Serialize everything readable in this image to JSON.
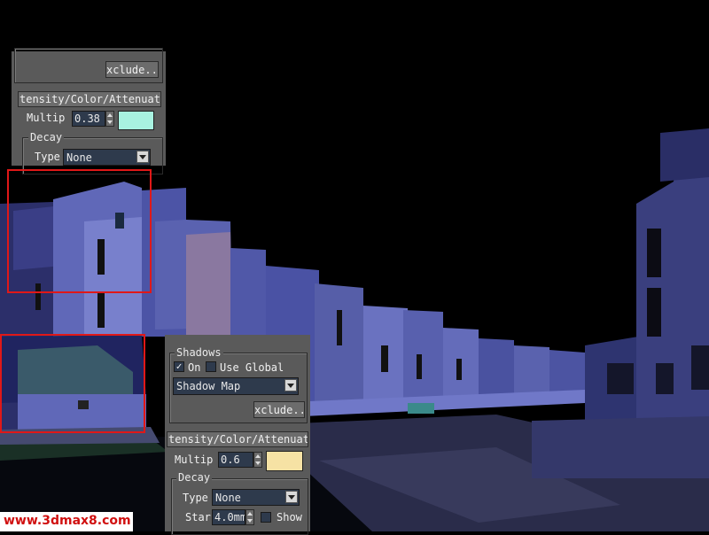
{
  "colors": {
    "panel_bg": "#5a5a5a",
    "field_bg": "#2e3a4c",
    "highlight": "#e01818",
    "upper_swatch": "#a8f2e0",
    "lower_swatch": "#f6e2a4",
    "scene_building": "#3c46a0",
    "watermark_text": "#d01010"
  },
  "upper_panel": {
    "exclude_label": "xclude..",
    "rollout_title": "tensity/Color/Attenuati",
    "multiplier_label": "Multip",
    "multiplier_value": "0.38",
    "decay_label": "Decay",
    "type_label": "Type",
    "type_value": "None"
  },
  "lower_panel": {
    "shadows_label": "Shadows",
    "on_checkbox_mark": "✓",
    "on_label": "On",
    "use_global_label": "Use Global",
    "shadow_type_value": "Shadow Map",
    "exclude_label": "xclude..",
    "rollout_title": "tensity/Color/Attenuati",
    "multiplier_label": "Multip",
    "multiplier_value": "0.6",
    "decay_label": "Decay",
    "type_label": "Type",
    "type_value": "None",
    "start_label": "Star",
    "start_value": "4.0mm",
    "show_label": "Show"
  },
  "watermark": {
    "text": "www.3dmax8.com"
  }
}
